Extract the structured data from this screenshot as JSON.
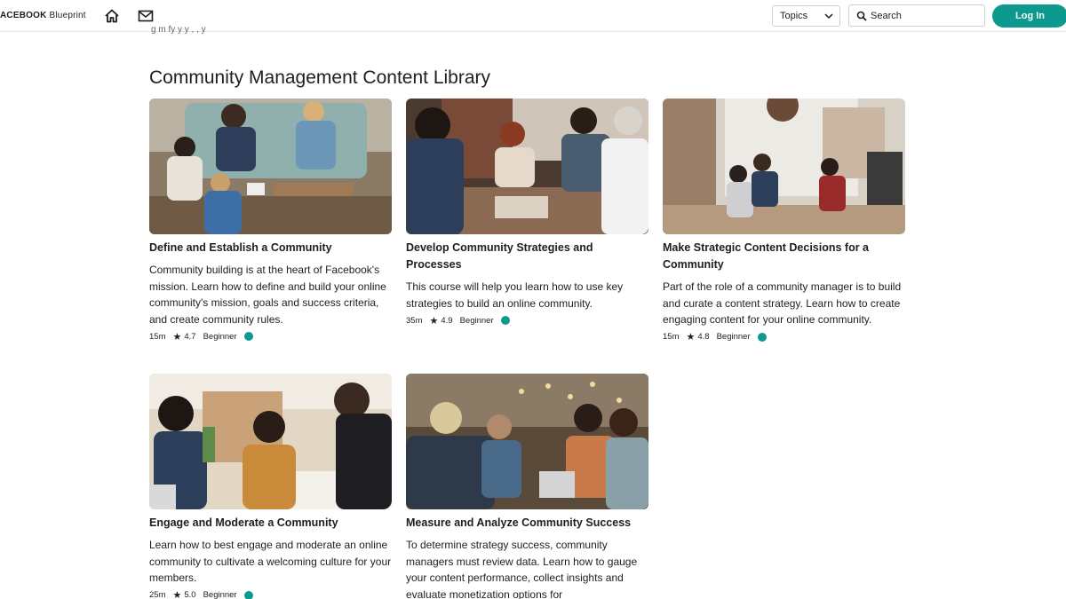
{
  "header": {
    "brand_main": "ACEBOOK",
    "brand_sub": "Blueprint",
    "topics_label": "Topics",
    "search_placeholder": "Search",
    "login_label": "Log In",
    "cutoff_text": "g         m           fy      y          y               ,           ,                                y"
  },
  "section": {
    "title": "Community Management Content Library"
  },
  "colors": {
    "accent": "#0b9a8d"
  },
  "cards": [
    {
      "title": "Define and Establish a Community",
      "description": "Community building is at the heart of Facebook's mission.  Learn how to define and build your online community's mission, goals and success criteria, and create community rules.",
      "duration": "15m",
      "rating": "4.7",
      "level": "Beginner"
    },
    {
      "title": "Develop Community Strategies and Processes",
      "description": "This course will help you learn how to use key strategies to build an online community.",
      "duration": "35m",
      "rating": "4.9",
      "level": "Beginner"
    },
    {
      "title": "Make Strategic Content Decisions for a Community",
      "description": "Part of the role of a community manager is to build and curate a content strategy. Learn how to create engaging content for your online community.",
      "duration": "15m",
      "rating": "4.8",
      "level": "Beginner"
    },
    {
      "title": "Engage and Moderate a Community",
      "description": "Learn how to best engage and moderate an online community to cultivate a welcoming culture for your members.",
      "duration": "25m",
      "rating": "5.0",
      "level": "Beginner"
    },
    {
      "title": "Measure and Analyze Community Success",
      "description": "To determine strategy success, community managers must review data. Learn how to gauge your content performance, collect insights and evaluate monetization options for",
      "duration": "",
      "rating": "",
      "level": ""
    }
  ]
}
